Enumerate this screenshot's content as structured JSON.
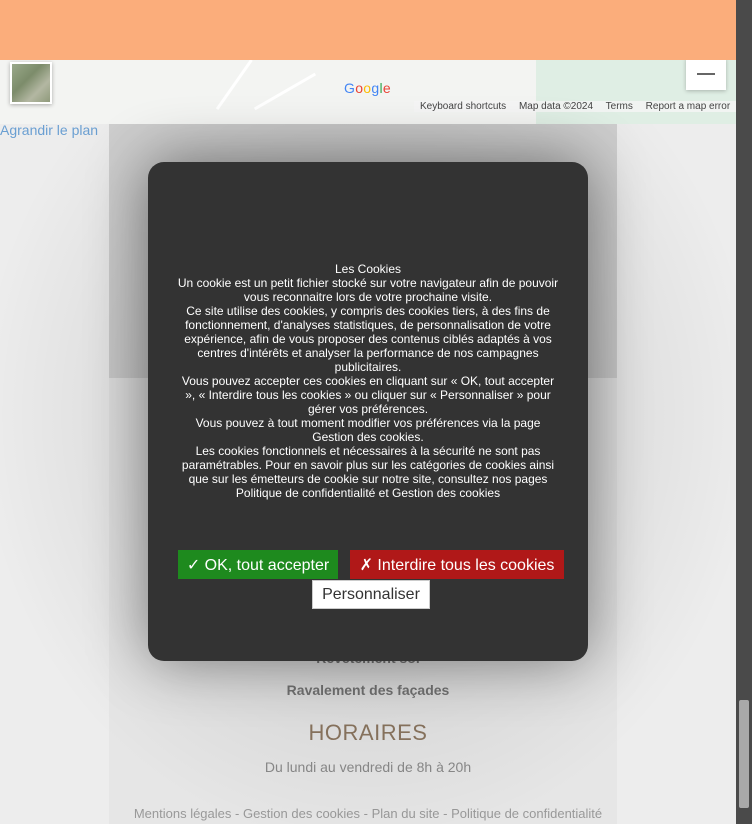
{
  "map": {
    "google_logo": "Google",
    "footer_items": [
      "Keyboard shortcuts",
      "Map data ©2024",
      "Terms",
      "Report a map error"
    ],
    "enlarge_link": "Agrandir le plan"
  },
  "page": {
    "service_1": "Revêtement sol",
    "service_2": "Ravalement des façades",
    "hours_title": "HORAIRES",
    "hours_text": "Du lundi au vendredi de 8h à 20h",
    "footer_links": [
      "Mentions légales",
      "Gestion des cookies",
      "Plan du site",
      "Politique de confidentialité"
    ],
    "footer_separator": " - "
  },
  "cookie": {
    "title": "Les Cookies",
    "paragraphs": [
      "Un cookie est un petit fichier stocké sur votre navigateur afin de pouvoir vous reconnaitre lors de votre prochaine visite.",
      "Ce site utilise des cookies, y compris des cookies tiers, à des fins de fonctionnement, d'analyses statistiques, de personnalisation de votre expérience, afin de vous proposer des contenus ciblés adaptés à vos centres d'intérêts et analyser la performance de nos campagnes publicitaires.",
      "Vous pouvez accepter ces cookies en cliquant sur « OK, tout accepter », «  Interdire tous les cookies  » ou cliquer sur « Personnaliser » pour gérer vos préférences.",
      "Vous pouvez à tout moment modifier vos préférences via la page Gestion des cookies.",
      "Les cookies fonctionnels et nécessaires à la sécurité ne sont pas paramétrables. Pour en savoir plus sur les catégories de cookies ainsi que sur les émetteurs de cookie sur notre site, consultez nos pages Politique de confidentialité et Gestion des cookies"
    ],
    "accept_label": "✓ OK, tout accepter",
    "deny_label": "✗ Interdire tous les cookies",
    "customize_label": "Personnaliser"
  },
  "colors": {
    "header_band": "#fbad7b",
    "modal_bg": "#333333",
    "accept_bg": "#1e8a1e",
    "deny_bg": "#b01818",
    "horaires_color": "#8b7660"
  }
}
